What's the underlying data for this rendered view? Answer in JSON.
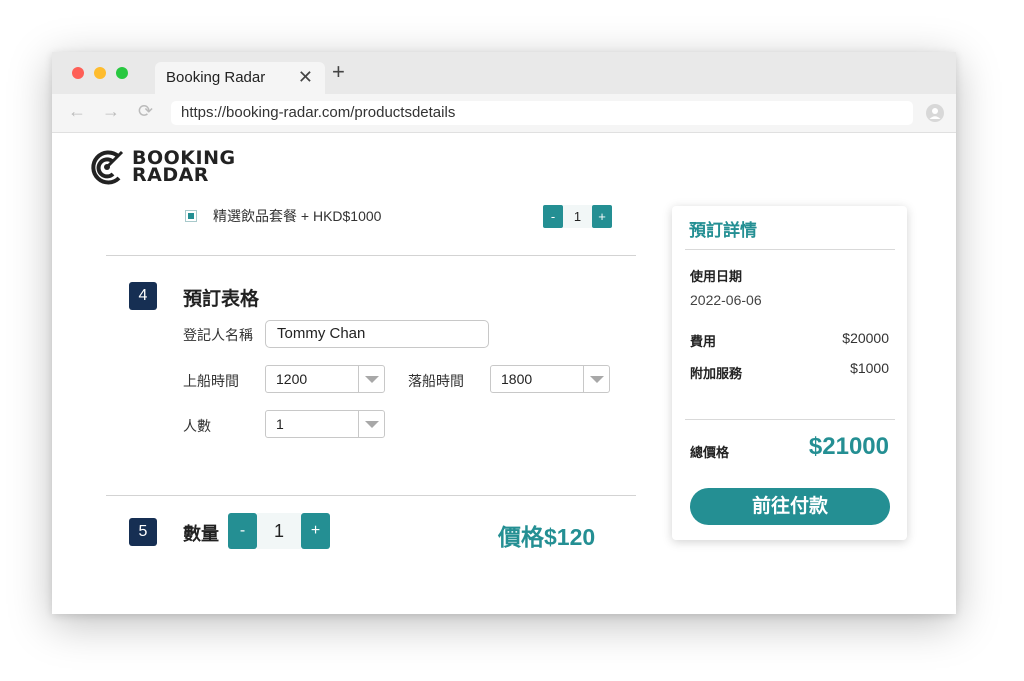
{
  "browser": {
    "tab_title": "Booking Radar",
    "close_symbol": "✕",
    "new_tab_symbol": "+",
    "back_symbol": "←",
    "forward_symbol": "→",
    "reload_symbol": "⟳",
    "url": "https://booking-radar.com/productsdetails"
  },
  "brand": {
    "line1": "BOOKING",
    "line2": "RADAR",
    "color": "#222222"
  },
  "addon": {
    "label": "精選飲品套餐 + HKD$1000",
    "checked": true,
    "stepper": {
      "minus": "-",
      "value": "1",
      "plus": "+"
    }
  },
  "section4": {
    "number": "4",
    "title": "預訂表格",
    "registrant_label": "登記人名稱",
    "registrant_value": "Tommy Chan",
    "boarding_label": "上船時間",
    "boarding_value": "1200",
    "alighting_label": "落船時間",
    "alighting_value": "1800",
    "people_label": "人數",
    "people_value": "1"
  },
  "section5": {
    "number": "5",
    "quantity_label": "數量",
    "stepper": {
      "minus": "-",
      "value": "1",
      "plus": "+"
    },
    "price": "價格$120"
  },
  "summary": {
    "title": "預訂詳情",
    "date_label": "使用日期",
    "date_value": "2022-06-06",
    "fee_label": "費用",
    "fee_value": "$20000",
    "addon_label": "附加服務",
    "addon_value": "$1000",
    "total_label": "總價格",
    "total_value": "$21000",
    "pay_button": "前往付款"
  },
  "colors": {
    "accent": "#248f93",
    "step_badge": "#162f53"
  },
  "icons": [
    "close-icon",
    "plus-icon",
    "back-arrow-icon",
    "forward-arrow-icon",
    "reload-icon",
    "profile-icon",
    "booking-radar-logo-icon",
    "dropdown-arrow-icon"
  ]
}
